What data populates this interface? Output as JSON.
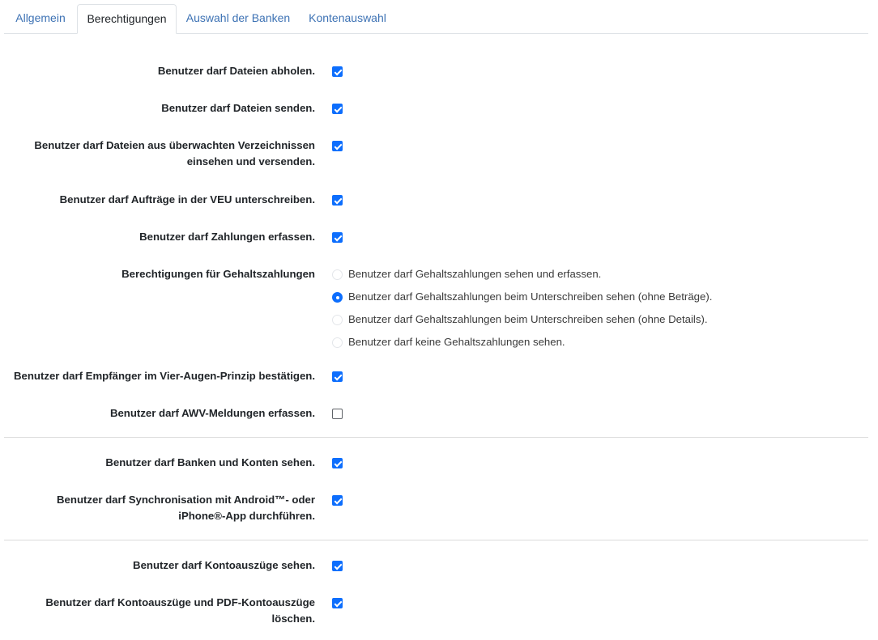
{
  "tabs": [
    {
      "label": "Allgemein",
      "active": false
    },
    {
      "label": "Berechtigungen",
      "active": true
    },
    {
      "label": "Auswahl der Banken",
      "active": false
    },
    {
      "label": "Kontenauswahl",
      "active": false
    }
  ],
  "permissions": {
    "fetch_files": {
      "label": "Benutzer darf Dateien abholen.",
      "checked": true
    },
    "send_files": {
      "label": "Benutzer darf Dateien senden.",
      "checked": true
    },
    "monitored_dirs": {
      "line1": "Benutzer darf Dateien aus überwachten Verzeichnissen",
      "line2": "einsehen und versenden.",
      "checked": true
    },
    "veu_sign": {
      "label": "Benutzer darf Aufträge in der VEU unterschreiben.",
      "checked": true
    },
    "create_payments": {
      "label": "Benutzer darf Zahlungen erfassen.",
      "checked": true
    },
    "salary": {
      "label": "Berechtigungen für Gehaltszahlungen",
      "options": [
        {
          "label": "Benutzer darf Gehaltszahlungen sehen und erfassen.",
          "selected": false
        },
        {
          "label": "Benutzer darf Gehaltszahlungen beim Unterschreiben sehen (ohne Beträge).",
          "selected": true
        },
        {
          "label": "Benutzer darf Gehaltszahlungen beim Unterschreiben sehen (ohne Details).",
          "selected": false
        },
        {
          "label": "Benutzer darf keine Gehaltszahlungen sehen.",
          "selected": false
        }
      ]
    },
    "four_eyes": {
      "label": "Benutzer darf Empfänger im Vier-Augen-Prinzip bestätigen.",
      "checked": true
    },
    "awv": {
      "label": "Benutzer darf AWV-Meldungen erfassen.",
      "checked": false
    },
    "banks_accounts": {
      "label": "Benutzer darf Banken und Konten sehen.",
      "checked": true
    },
    "app_sync": {
      "line1": "Benutzer darf Synchronisation mit Android™- oder",
      "line2": "iPhone®-App durchführen.",
      "checked": true
    },
    "statements_view": {
      "label": "Benutzer darf Kontoauszüge sehen.",
      "checked": true
    },
    "statements_delete": {
      "line1": "Benutzer darf Kontoauszüge und PDF-Kontoauszüge",
      "line2": "löschen.",
      "checked": true
    }
  },
  "colors": {
    "accent": "#0d6efd",
    "tab_link": "#3d72b4"
  }
}
